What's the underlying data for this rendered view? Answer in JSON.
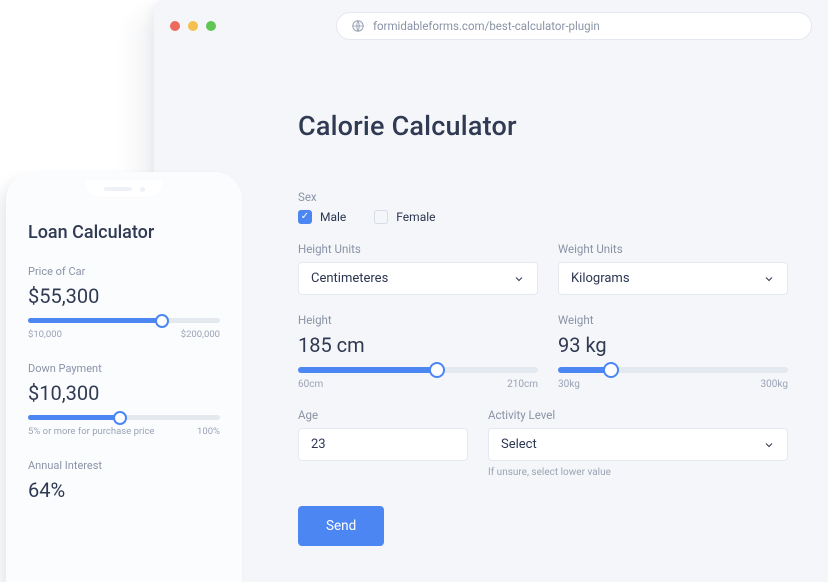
{
  "browser": {
    "url": "formidableforms.com/best-calculator-plugin"
  },
  "calorie": {
    "title": "Calorie Calculator",
    "sex_label": "Sex",
    "male_label": "Male",
    "female_label": "Female",
    "height_units_label": "Height Units",
    "height_units_value": "Centimeteres",
    "weight_units_label": "Weight Units",
    "weight_units_value": "Kilograms",
    "height_label": "Height",
    "height_value": "185 cm",
    "height_min": "60cm",
    "height_max": "210cm",
    "weight_label": "Weight",
    "weight_value": "93 kg",
    "weight_min": "30kg",
    "weight_max": "300kg",
    "age_label": "Age",
    "age_value": "23",
    "activity_label": "Activity Level",
    "activity_value": "Select",
    "activity_hint": "If unsure, select lower value",
    "send_label": "Send"
  },
  "loan": {
    "title": "Loan Calculator",
    "price_label": "Price of Car",
    "price_value": "$55,300",
    "price_min": "$10,000",
    "price_max": "$200,000",
    "down_label": "Down Payment",
    "down_value": "$10,300",
    "down_min": "5% or more for purchase price",
    "down_max": "100%",
    "interest_label": "Annual Interest",
    "interest_value": "64%"
  }
}
